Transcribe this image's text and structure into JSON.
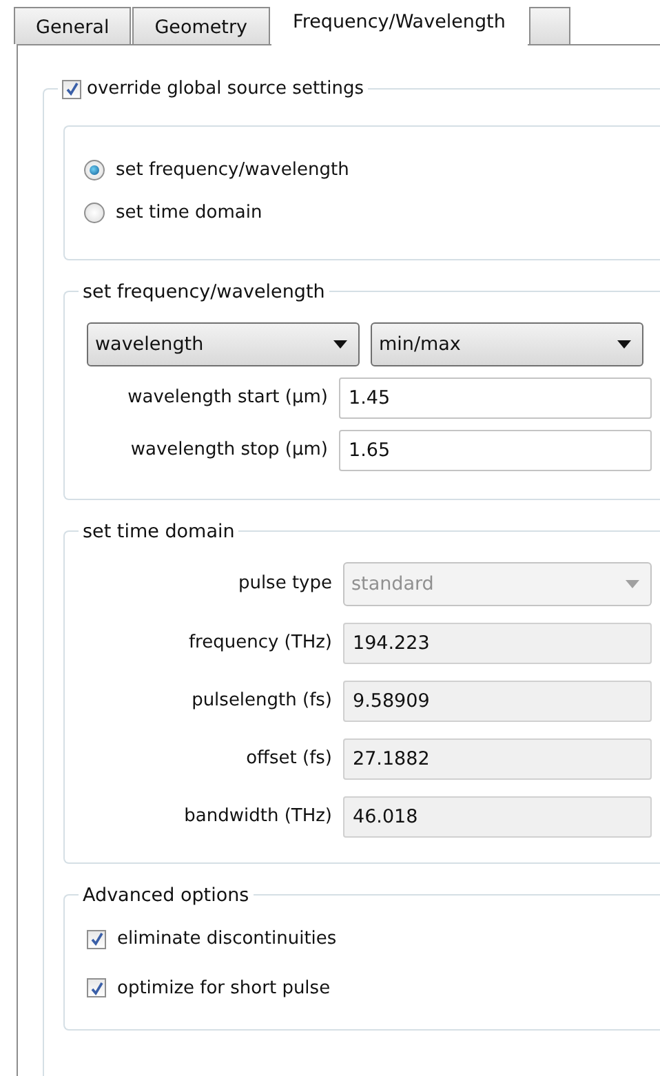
{
  "tabs": [
    {
      "label": "General",
      "selected": false
    },
    {
      "label": "Geometry",
      "selected": false
    },
    {
      "label": "Frequency/Wavelength",
      "selected": true
    }
  ],
  "override": {
    "label": "override global source settings",
    "checked": true
  },
  "source_mode": [
    {
      "label": "set frequency/wavelength",
      "selected": true
    },
    {
      "label": "set time domain",
      "selected": false
    }
  ],
  "frequency_group": {
    "title": "set frequency/wavelength",
    "dropdowns": [
      {
        "value": "wavelength"
      },
      {
        "value": "min/max"
      }
    ],
    "fields": [
      {
        "label": "wavelength start (µm)",
        "value": "1.45",
        "disabled": false
      },
      {
        "label": "wavelength stop (µm)",
        "value": "1.65",
        "disabled": false
      }
    ]
  },
  "time_domain": {
    "title": "set time domain",
    "pulse_type": {
      "label": "pulse type",
      "value": "standard",
      "disabled": true
    },
    "fields": [
      {
        "label": "frequency (THz)",
        "value": "194.223",
        "disabled": true
      },
      {
        "label": "pulselength (fs)",
        "value": "9.58909",
        "disabled": true
      },
      {
        "label": "offset (fs)",
        "value": "27.1882",
        "disabled": true
      },
      {
        "label": "bandwidth (THz)",
        "value": "46.018",
        "disabled": true
      }
    ]
  },
  "advanced": {
    "title": "Advanced options",
    "options": [
      {
        "label": "eliminate discontinuities",
        "checked": true
      },
      {
        "label": "optimize for short pulse",
        "checked": true
      }
    ]
  }
}
